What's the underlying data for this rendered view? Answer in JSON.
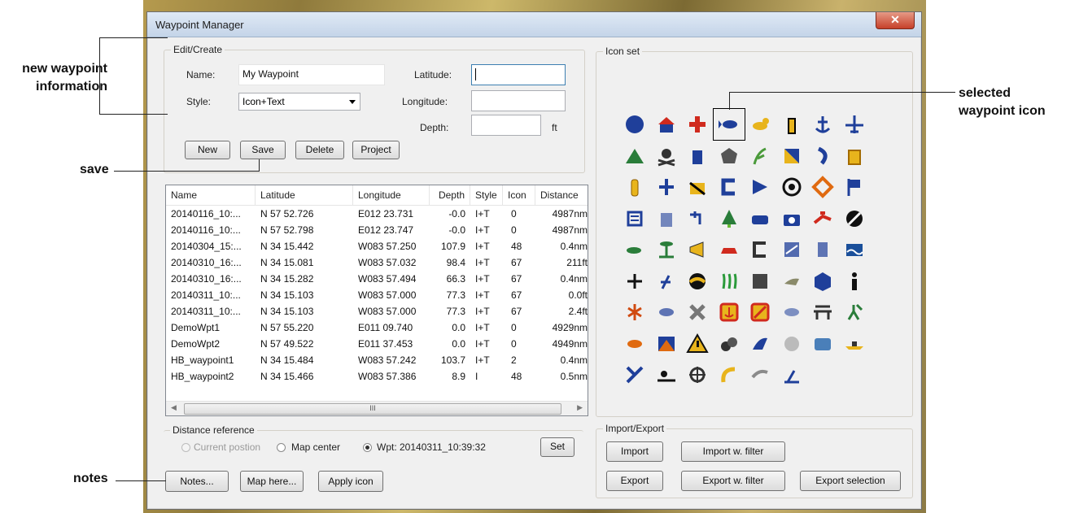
{
  "window": {
    "title": "Waypoint Manager",
    "close_glyph": "✕"
  },
  "edit": {
    "group_label": "Edit/Create",
    "name_label": "Name:",
    "name_value": "My Waypoint",
    "style_label": "Style:",
    "style_value": "Icon+Text",
    "latitude_label": "Latitude:",
    "latitude_value": "",
    "longitude_label": "Longitude:",
    "longitude_value": "",
    "depth_label": "Depth:",
    "depth_value": "",
    "depth_unit": "ft",
    "buttons": {
      "new": "New",
      "save": "Save",
      "delete": "Delete",
      "project": "Project"
    }
  },
  "table": {
    "columns": [
      "Name",
      "Latitude",
      "Longitude",
      "Depth",
      "Style",
      "Icon",
      "Distance"
    ],
    "rows": [
      [
        "20140116_10:...",
        "N 57 52.726",
        "E012 23.731",
        "-0.0",
        "I+T",
        "0",
        "4987nm"
      ],
      [
        "20140116_10:...",
        "N 57 52.798",
        "E012 23.747",
        "-0.0",
        "I+T",
        "0",
        "4987nm"
      ],
      [
        "20140304_15:...",
        "N 34 15.442",
        "W083 57.250",
        "107.9",
        "I+T",
        "48",
        "0.4nm"
      ],
      [
        "20140310_16:...",
        "N 34 15.081",
        "W083 57.032",
        "98.4",
        "I+T",
        "67",
        "211ft"
      ],
      [
        "20140310_16:...",
        "N 34 15.282",
        "W083 57.494",
        "66.3",
        "I+T",
        "67",
        "0.4nm"
      ],
      [
        "20140311_10:...",
        "N 34 15.103",
        "W083 57.000",
        "77.3",
        "I+T",
        "67",
        "0.0ft"
      ],
      [
        "20140311_10:...",
        "N 34 15.103",
        "W083 57.000",
        "77.3",
        "I+T",
        "67",
        "2.4ft"
      ],
      [
        "DemoWpt1",
        "N 57 55.220",
        "E011 09.740",
        "0.0",
        "I+T",
        "0",
        "4929nm"
      ],
      [
        "DemoWpt2",
        "N 57 49.522",
        "E011 37.453",
        "0.0",
        "I+T",
        "0",
        "4949nm"
      ],
      [
        "HB_waypoint1",
        "N 34 15.484",
        "W083 57.242",
        "103.7",
        "I+T",
        "2",
        "0.4nm"
      ],
      [
        "HB_waypoint2",
        "N 34 15.466",
        "W083 57.386",
        "8.9",
        "I",
        "48",
        "0.5nm"
      ]
    ],
    "scroll_grip": "III"
  },
  "distance": {
    "group_label": "Distance reference",
    "opt_current": "Current postion",
    "opt_map": "Map center",
    "opt_wpt": "Wpt: 20140311_10:39:32",
    "set_button": "Set"
  },
  "bottom_buttons": {
    "notes": "Notes...",
    "map_here": "Map here...",
    "apply_icon": "Apply icon"
  },
  "iconset": {
    "group_label": "Icon set",
    "icons": [
      "circle-icon",
      "house-icon",
      "red-cross-icon",
      "fish-icon",
      "duck-icon",
      "lighthouse-icon",
      "anchor-icon",
      "airplane-icon",
      "tent-icon",
      "skull-crossbones-icon",
      "mug-icon",
      "rock-icon",
      "weed-icon",
      "flag-diagonal-icon",
      "hook-icon",
      "beer-mug-icon",
      "bottle-icon",
      "junction-icon",
      "hazard-stripes-icon",
      "letter-c-icon",
      "nav-marker-icon",
      "target-icon",
      "diamond-icon",
      "flag-icon",
      "list-icon",
      "building-icon",
      "faucet-icon",
      "tree-icon",
      "car-group-icon",
      "camera-icon",
      "diver-icon",
      "no-entry-icon",
      "small-fish-icon",
      "island-icon",
      "horn-icon",
      "car-icon",
      "copyright-icon",
      "chart-icon",
      "buoy-icon",
      "wave-icon",
      "plus-icon",
      "swimmer-icon",
      "half-sphere-icon",
      "grass-icon",
      "rubble-icon",
      "bird-icon",
      "cube-icon",
      "info-icon",
      "lobster-icon",
      "bass-icon",
      "starfish-icon",
      "anchor-badge-icon",
      "no-fishing-icon",
      "catfish-icon",
      "bridge-icon",
      "fisherman-icon",
      "orange-fish-icon",
      "sunset-icon",
      "warning-icon",
      "rocks-icon",
      "wreck-icon",
      "coral-icon",
      "lake-icon",
      "boat-icon",
      "crossed-icon",
      "swim-icon",
      "shellfish-icon",
      "shrimp-icon",
      "bird-hunt-icon",
      "dock-icon"
    ],
    "selected_index": 3
  },
  "import_export": {
    "group_label": "Import/Export",
    "import": "Import",
    "import_filter": "Import w. filter",
    "export": "Export",
    "export_filter": "Export w. filter",
    "export_selection": "Export selection"
  },
  "callouts": {
    "new_waypoint": "new waypoint\ninformation",
    "save": "save",
    "notes": "notes",
    "selected_icon": "selected\nwaypoint icon"
  },
  "colors": {
    "accent": "#3c7fb1",
    "icon_blue": "#1f3f9a",
    "icon_red": "#d02a1e",
    "icon_yellow": "#e8b41c"
  }
}
